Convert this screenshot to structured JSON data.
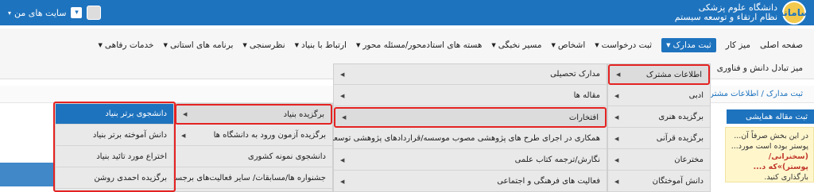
{
  "header": {
    "logo_title_line1": "دانشگاه علوم پزشکی",
    "logo_title_line2": "نظام ارتقاء و توسعه سیستم",
    "logo_badge": "سامانه",
    "my_sites_label": "سایت های من",
    "colors": {
      "bar": "#1e73be",
      "badge": "#f2c94c"
    }
  },
  "nav": {
    "row1": [
      {
        "label": "صفحه اصلی",
        "caret": false
      },
      {
        "label": "میز کار",
        "caret": false
      },
      {
        "label": "ثبت مدارک",
        "caret": true,
        "active": true
      },
      {
        "label": "ثبت درخواست",
        "caret": true
      },
      {
        "label": "اشخاص",
        "caret": true
      },
      {
        "label": "مسیر نخبگی",
        "caret": true
      },
      {
        "label": "هسته های استادمحور/مسئله محور",
        "caret": true
      },
      {
        "label": "ارتباط با بنیاد",
        "caret": true
      },
      {
        "label": "نظرسنجی",
        "caret": true
      },
      {
        "label": "برنامه های استانی",
        "caret": true
      },
      {
        "label": "خدمات رفاهی",
        "caret": true
      }
    ],
    "row2_item": "میز تبادل دانش و فناوری"
  },
  "breadcrumb": "ثبت مدارک / اطلاعات مشترک",
  "right_panel": {
    "title": "ثبت مقاله همایشی",
    "info_lines": [
      "در این بخش صرفاً آن...",
      "پوستر بوده است مورد...",
      "(سخنرانی/ پوستر)»که د...",
      "بارگذاری کنید."
    ]
  },
  "menu": {
    "col1": [
      {
        "label": "اطلاعات مشترک",
        "arrow": true,
        "highlight": true
      },
      {
        "label": "ادبی",
        "arrow": true
      },
      {
        "label": "برگزیده هنری",
        "arrow": true
      },
      {
        "label": "برگزیده قرآنی",
        "arrow": true
      },
      {
        "label": "مخترعان",
        "arrow": true
      },
      {
        "label": "دانش آموختگان",
        "arrow": true
      }
    ],
    "col2": [
      {
        "label": "مدارک تحصیلی",
        "arrow": true
      },
      {
        "label": "مقاله ها",
        "arrow": true
      },
      {
        "label": "افتخارات",
        "arrow": true,
        "highlight": true
      },
      {
        "label": "همکاری در اجرای طرح های پژوهشی مصوب موسسه/قراردادهای پژوهشی توسعه ای",
        "arrow": true
      },
      {
        "label": "نگارش/ترجمه کتاب علمی",
        "arrow": true
      },
      {
        "label": "فعالیت های فرهنگی و اجتماعی",
        "arrow": true
      }
    ],
    "col3": [
      {
        "label": "برگزیده بنیاد",
        "arrow": true,
        "highlight": true
      },
      {
        "label": "برگزیده آزمون ورود به دانشگاه ها",
        "arrow": true
      },
      {
        "label": "دانشجوی نمونه کشوری",
        "arrow": false
      },
      {
        "label": "جشنواره ها/مسابقات/ سایر فعالیت‌های برجسته",
        "arrow": true
      }
    ],
    "col4": [
      {
        "label": "دانشجوی برتر بنیاد",
        "selected": true
      },
      {
        "label": "دانش آموخته برتر بنیاد"
      },
      {
        "label": "اختراع مورد تائید بنیاد"
      },
      {
        "label": "برگزیده احمدی روشن"
      }
    ]
  }
}
